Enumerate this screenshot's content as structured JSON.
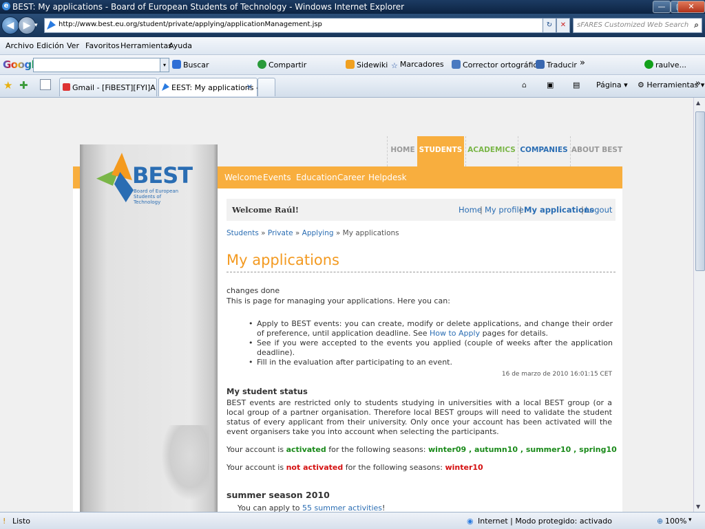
{
  "window": {
    "title": "BEST: My applications - Board of European Students of Technology - Windows Internet Explorer",
    "ie_glyph": "e",
    "minimize": "—",
    "maximize": "▢",
    "close": "✕"
  },
  "address_bar": {
    "back": "◀",
    "forward": "▶",
    "history": "▾",
    "url": "http://www.best.eu.org/student/private/applying/applicationManagement.jsp",
    "url_dropdown": "▾",
    "refresh": "↻",
    "stop": "✕",
    "search_placeholder": "sFARES Customized Web Search",
    "search_button": "⌕"
  },
  "menu": [
    "Archivo",
    "Edición",
    "Ver",
    "Favoritos",
    "Herramientas",
    "Ayuda"
  ],
  "google_toolbar": {
    "logo": "Google",
    "dropdown": "▾",
    "buscar": "Buscar",
    "compartir": "Compartir",
    "sidewiki": "Sidewiki",
    "marcadores": "Marcadores",
    "corrector": "Corrector ortográfico",
    "traducir": "Traducir",
    "more": "»",
    "user": "raulve..."
  },
  "tabs_bar": {
    "tabs": [
      {
        "label": "Gmail - [FiBEST][FYI]A las ..."
      },
      {
        "label": "EEST: My applications - ..."
      }
    ],
    "close_glyph": "✕",
    "pagina": "Página",
    "herramientas": "Herramientas",
    "more": "»"
  },
  "page": {
    "logo": {
      "name": "BEST",
      "sub": "Board of European Students of Technology"
    },
    "top_nav": [
      "HOME",
      "STUDENTS",
      "ACADEMICS",
      "COMPANIES",
      "ABOUT BEST"
    ],
    "orange_nav": [
      "Welcome",
      "Events",
      "Education",
      "Career",
      "Helpdesk"
    ],
    "welcome": "Welcome Raúl!",
    "user_links": [
      "Home",
      "My profile",
      "My applications",
      "Logout"
    ],
    "separator": "|",
    "breadcrumb": {
      "items": [
        "Students",
        "Private",
        "Applying"
      ],
      "current": "My applications",
      "sep": " » "
    },
    "heading": "My applications",
    "changes_done": "changes done",
    "intro": "This is page for managing your applications. Here you can:",
    "bullets": {
      "b1_pre": "Apply to BEST events: you can create, modify or delete applications, and change their order of preference, until application deadline. See ",
      "b1_link": "How to Apply",
      "b1_post": " pages for details.",
      "b2": "See if you were accepted to the events you applied (couple of weeks after the application deadline).",
      "b3": "Fill in the evaluation after participating to an event."
    },
    "datestamp": "16 de marzo de 2010 16:01:15 CET",
    "student_status": {
      "heading": "My student status",
      "text": "BEST events are restricted only to students studying in universities with a local BEST group (or a local group of a partner organisation. Therefore local BEST groups will need to validate the student status of every applicant from their university. Only once your account has been activated will the event organisers take you into account when selecting the participants.",
      "active_pre": "Your account is ",
      "active_word": "activated",
      "active_mid": " for the following seasons: ",
      "active_seasons": "winter09 , autumn10 , summer10 , spring10",
      "inactive_pre": "Your account is ",
      "inactive_word": "not activated",
      "inactive_mid": " for the following seasons: ",
      "inactive_seasons": "winter10"
    },
    "season": {
      "heading": "summer season 2010",
      "pre": "You can apply to ",
      "link": "55 summer activities",
      "post": "!"
    }
  },
  "status_bar": {
    "left": "Listo",
    "zone": "Internet | Modo protegido: activado",
    "zoom": "100%"
  },
  "colors": {
    "orange": "#f8ae3e",
    "heading_orange": "#f39a21",
    "link_blue": "#2a6db3",
    "green": "#1a8a1a",
    "red": "#d41010",
    "ie_title": "#1c3b63"
  }
}
